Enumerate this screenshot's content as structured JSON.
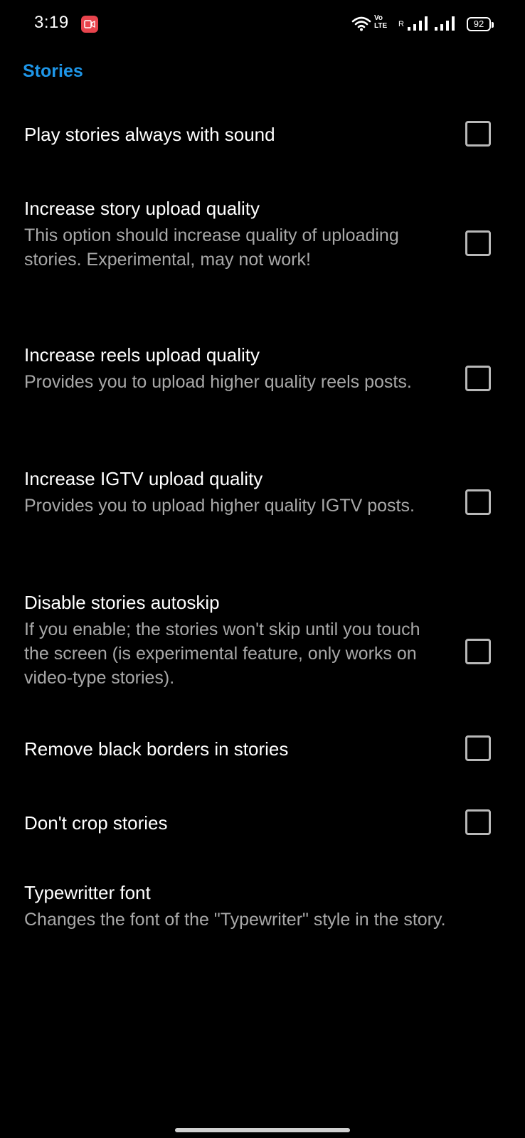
{
  "status_bar": {
    "time": "3:19",
    "recording_icon": "screen-record-icon",
    "volte_line1": "Vo",
    "volte_line2": "LTE",
    "roaming": "R",
    "battery": "92"
  },
  "section": {
    "title": "Stories"
  },
  "preferences": [
    {
      "title": "Play stories always with sound",
      "summary": "",
      "checked": false
    },
    {
      "title": "Increase story upload quality",
      "summary": "This option should increase quality of uploading stories. Experimental, may not work!",
      "checked": false
    },
    {
      "title": "Increase reels upload quality",
      "summary": "Provides you to upload higher quality reels posts.",
      "checked": false
    },
    {
      "title": "Increase IGTV upload quality",
      "summary": "Provides you to upload higher quality IGTV posts.",
      "checked": false
    },
    {
      "title": "Disable stories autoskip",
      "summary": "If you enable; the stories won't skip until you touch the screen (is experimental feature, only works on video-type stories).",
      "checked": false
    },
    {
      "title": "Remove black borders in stories",
      "summary": "",
      "checked": false
    },
    {
      "title": "Don't crop stories",
      "summary": "",
      "checked": false
    },
    {
      "title": "Typewritter font",
      "summary": "Changes the font of the \"Typewriter\" style in the story."
    }
  ],
  "colors": {
    "background": "#000000",
    "accent": "#1e96e8",
    "title_text": "#ffffff",
    "summary_text": "#a8a8a8",
    "checkbox_border": "#b8b8b8"
  }
}
